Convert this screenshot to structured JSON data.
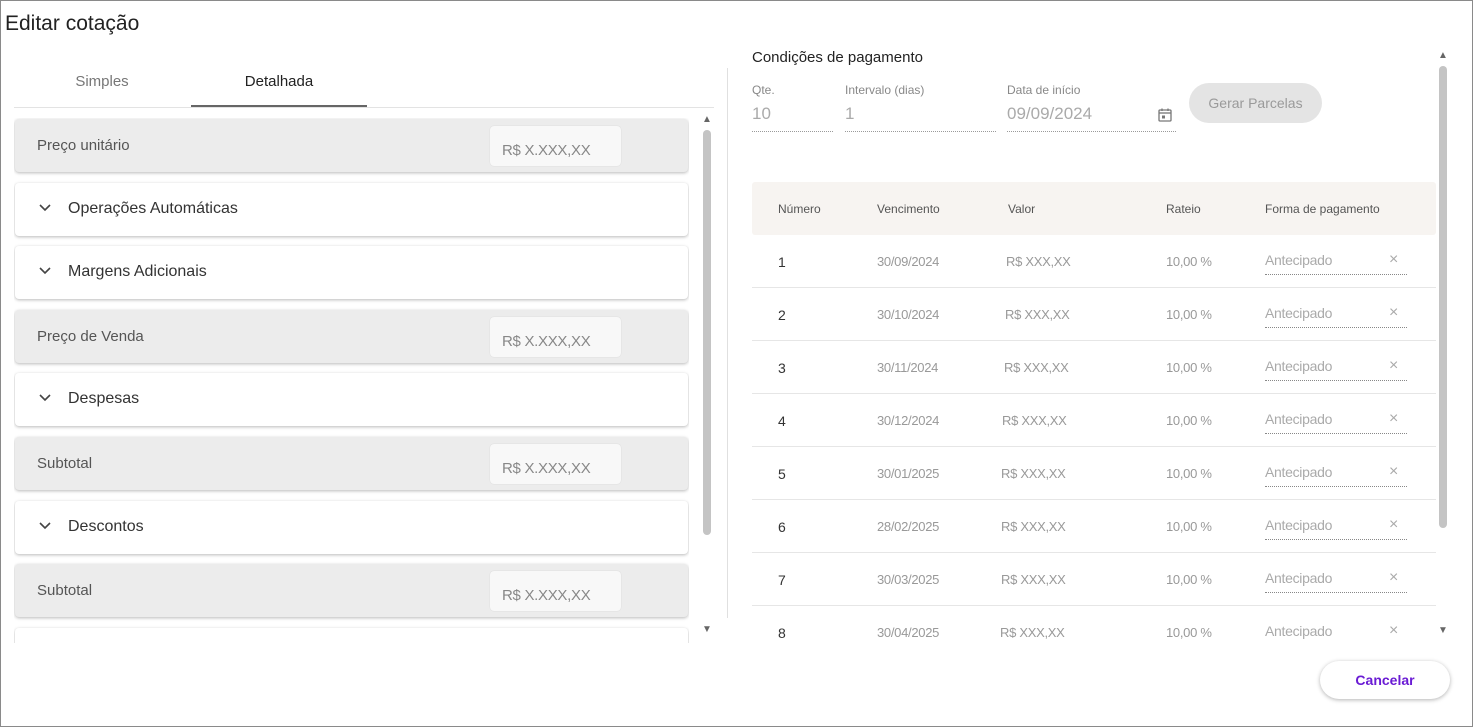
{
  "dialog": {
    "title": "Editar cotação"
  },
  "tabs": [
    {
      "label": "Simples"
    },
    {
      "label": "Detalhada"
    }
  ],
  "pricing": {
    "preco_unitario": {
      "label": "Preço unitário",
      "value": "R$ X.XXX,XX"
    },
    "operacoes": {
      "label": "Operações Automáticas"
    },
    "margens": {
      "label": "Margens Adicionais"
    },
    "preco_venda": {
      "label": "Preço de Venda",
      "value": "R$ X.XXX,XX"
    },
    "despesas": {
      "label": "Despesas"
    },
    "subtotal1": {
      "label": "Subtotal",
      "value": "R$ X.XXX,XX"
    },
    "descontos": {
      "label": "Descontos"
    },
    "subtotal2": {
      "label": "Subtotal",
      "value": "R$ X.XXX,XX"
    }
  },
  "payment": {
    "title": "Condições de pagamento",
    "qte": {
      "label": "Qte.",
      "value": "10"
    },
    "intervalo": {
      "label": "Intervalo (dias)",
      "value": "1"
    },
    "data_inicio": {
      "label": "Data de início",
      "value": "09/09/2024"
    },
    "generate_button": "Gerar Parcelas",
    "columns": [
      "Número",
      "Vencimento",
      "Valor",
      "Rateio",
      "Forma de pagamento"
    ],
    "rows": [
      {
        "numero": "1",
        "vencimento": "30/09/2024",
        "valor": "R$ XXX,XX",
        "rateio": "10,00 %",
        "forma": "Antecipado"
      },
      {
        "numero": "2",
        "vencimento": "30/10/2024",
        "valor": "R$ XXX,XX",
        "rateio": "10,00 %",
        "forma": "Antecipado"
      },
      {
        "numero": "3",
        "vencimento": "30/11/2024",
        "valor": "R$ XXX,XX",
        "rateio": "10,00 %",
        "forma": "Antecipado"
      },
      {
        "numero": "4",
        "vencimento": "30/12/2024",
        "valor": "R$ XXX,XX",
        "rateio": "10,00 %",
        "forma": "Antecipado"
      },
      {
        "numero": "5",
        "vencimento": "30/01/2025",
        "valor": "R$ XXX,XX",
        "rateio": "10,00 %",
        "forma": "Antecipado"
      },
      {
        "numero": "6",
        "vencimento": "28/02/2025",
        "valor": "R$ XXX,XX",
        "rateio": "10,00 %",
        "forma": "Antecipado"
      },
      {
        "numero": "7",
        "vencimento": "30/03/2025",
        "valor": "R$ XXX,XX",
        "rateio": "10,00 %",
        "forma": "Antecipado"
      },
      {
        "numero": "8",
        "vencimento": "30/04/2025",
        "valor": "R$ XXX,XX",
        "rateio": "10,00 %",
        "forma": "Antecipado"
      }
    ],
    "clear_symbol": "×"
  },
  "footer": {
    "cancel_label": "Cancelar"
  },
  "colors": {
    "accent": "#6a1bd4",
    "header_bg": "#f7f4f1",
    "field_bg": "#ececec"
  }
}
